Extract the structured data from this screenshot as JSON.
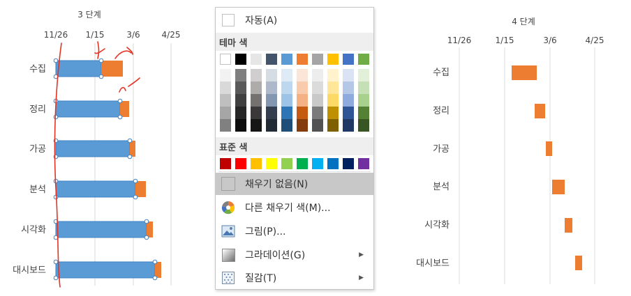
{
  "left_chart": {
    "title": "3 단계",
    "ticks": [
      "11/26",
      "1/15",
      "3/6",
      "4/25"
    ],
    "categories": [
      "수집",
      "정리",
      "가공",
      "분석",
      "시각화",
      "대시보드"
    ]
  },
  "right_chart": {
    "title": "4 단계",
    "ticks": [
      "11/26",
      "1/15",
      "3/6",
      "4/25"
    ],
    "categories": [
      "수집",
      "정리",
      "가공",
      "분석",
      "시각화",
      "대시보드"
    ]
  },
  "menu": {
    "automatic_label": "자동(A)",
    "theme_colors_label": "테마 색",
    "standard_colors_label": "표준 색",
    "no_fill_label": "채우기 없음(N)",
    "more_colors_label": "다른 채우기 색(M)...",
    "picture_label": "그림(P)...",
    "gradient_label": "그라데이션(G)",
    "texture_label": "질감(T)",
    "theme_top": [
      "#ffffff",
      "#000000",
      "#e7e6e6",
      "#44546a",
      "#5b9bd5",
      "#ed7d31",
      "#a5a5a5",
      "#ffc000",
      "#4472c4",
      "#70ad47"
    ],
    "theme_shades": [
      [
        "#f2f2f2",
        "#d9d9d9",
        "#bfbfbf",
        "#a6a6a6",
        "#808080"
      ],
      [
        "#7f7f7f",
        "#595959",
        "#404040",
        "#262626",
        "#0d0d0d"
      ],
      [
        "#d0cece",
        "#aeabab",
        "#757171",
        "#3a3838",
        "#171616"
      ],
      [
        "#d6dce4",
        "#adb9ca",
        "#8497b0",
        "#333f4f",
        "#222a35"
      ],
      [
        "#deebf6",
        "#bdd7ee",
        "#9dc3e6",
        "#2e75b5",
        "#1f4e79"
      ],
      [
        "#fbe5d6",
        "#f8cbad",
        "#f4b183",
        "#c55a11",
        "#833c0b"
      ],
      [
        "#ededed",
        "#dbdbdb",
        "#c9c9c9",
        "#7b7b7b",
        "#525252"
      ],
      [
        "#fff2cc",
        "#ffe699",
        "#ffd966",
        "#bf9000",
        "#7f6000"
      ],
      [
        "#dae3f3",
        "#b4c7e7",
        "#8faadc",
        "#2f5597",
        "#1f3864"
      ],
      [
        "#e2f0d9",
        "#c5e0b4",
        "#a9d18e",
        "#548235",
        "#375623"
      ]
    ],
    "standard": [
      "#c00000",
      "#ff0000",
      "#ffc000",
      "#ffff00",
      "#92d050",
      "#00b050",
      "#00b0f0",
      "#0070c0",
      "#002060",
      "#7030a0"
    ]
  }
}
